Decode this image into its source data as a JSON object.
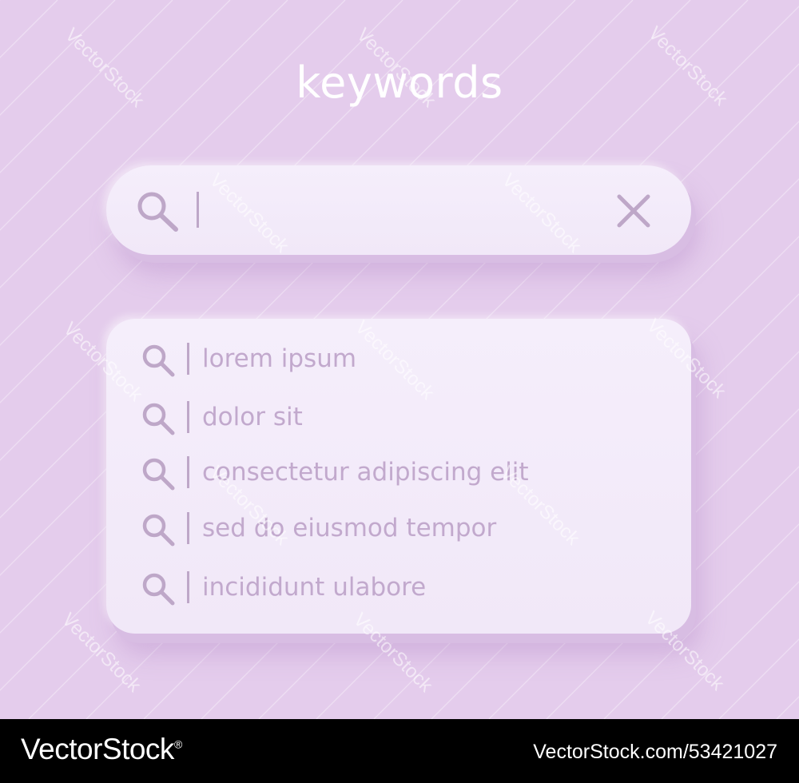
{
  "page": {
    "title": "keywords",
    "background_color": "#e4ccec",
    "icon_color": "#bea7c8",
    "text_color": "#c2a9cd"
  },
  "search": {
    "value": "",
    "search_icon": "search-icon",
    "clear_icon": "close-icon"
  },
  "suggestions": [
    {
      "label": "lorem ipsum",
      "icon": "search-icon"
    },
    {
      "label": "dolor sit",
      "icon": "search-icon"
    },
    {
      "label": "consectetur adipiscing elit",
      "icon": "search-icon"
    },
    {
      "label": "sed do eiusmod tempor",
      "icon": "search-icon"
    },
    {
      "label": "incididunt ulabore",
      "icon": "search-icon"
    }
  ],
  "watermark": {
    "text": "VectorStock"
  },
  "footer": {
    "brand": "VectorStock",
    "brand_reg": "®",
    "image_id": "VectorStock.com/53421027"
  }
}
